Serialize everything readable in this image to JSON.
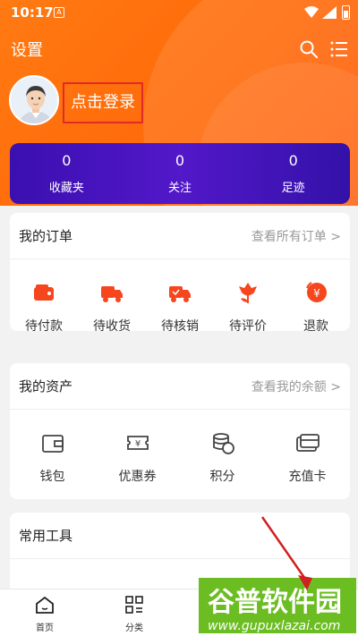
{
  "status_bar": {
    "time": "10:17",
    "notif_glyph": "A"
  },
  "header": {
    "title": "设置",
    "login_label": "点击登录"
  },
  "stats": [
    {
      "value": "0",
      "label": "收藏夹"
    },
    {
      "value": "0",
      "label": "关注"
    },
    {
      "value": "0",
      "label": "足迹"
    }
  ],
  "orders": {
    "title": "我的订单",
    "more": "查看所有订单 >",
    "items": [
      {
        "label": "待付款",
        "icon": "wallet-icon"
      },
      {
        "label": "待收货",
        "icon": "truck-icon"
      },
      {
        "label": "待核销",
        "icon": "truck-check-icon"
      },
      {
        "label": "待评价",
        "icon": "flower-icon"
      },
      {
        "label": "退款",
        "icon": "refund-icon"
      }
    ]
  },
  "assets": {
    "title": "我的资产",
    "more": "查看我的余额 >",
    "items": [
      {
        "label": "钱包",
        "icon": "wallet-outline-icon"
      },
      {
        "label": "优惠券",
        "icon": "coupon-icon"
      },
      {
        "label": "积分",
        "icon": "coins-icon"
      },
      {
        "label": "充值卡",
        "icon": "card-icon"
      }
    ]
  },
  "tools": {
    "title": "常用工具"
  },
  "bottom_nav": [
    {
      "label": "首页",
      "icon": "home-icon"
    },
    {
      "label": "分类",
      "icon": "category-icon"
    }
  ],
  "watermark": {
    "line1": "谷普软件园",
    "line2": "www.gupuxlazai.com"
  },
  "colors": {
    "orange": "#ff6a0a",
    "purple": "#4515be",
    "accent_red": "#e02a2a"
  }
}
